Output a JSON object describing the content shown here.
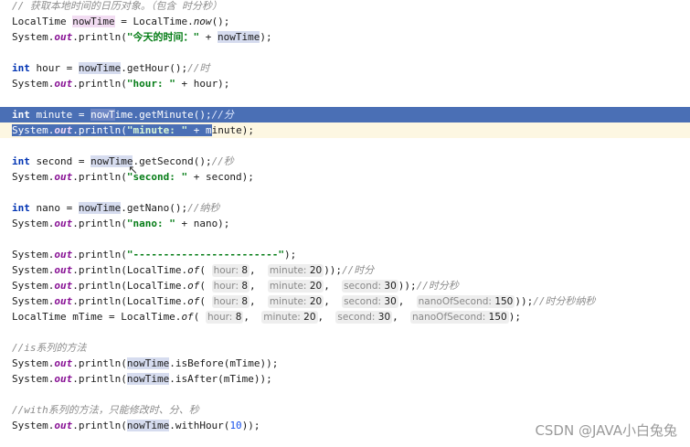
{
  "lines": {
    "l1": "// 获取本地时间的日历对象。（包含 时分秒）",
    "l2_type": "LocalTime",
    "l2_var": "nowTime",
    "l2_eq": " = LocalTime.",
    "l2_method": "now",
    "l2_end": "();",
    "l3_pre": "System.",
    "l3_out": "out",
    "l3_mid": ".println(",
    "l3_str": "\"今天的时间：\"",
    "l3_plus": " + ",
    "l3_var": "nowTime",
    "l3_end": ");",
    "l5_kw": "int",
    "l5_mid": " hour = ",
    "l5_var": "nowTime",
    "l5_call": ".getHour();",
    "l5_cm": "//时",
    "l6_str": "\"hour: \"",
    "l6_end": " + hour);",
    "l8_kw": "int",
    "l8_mid": " minute = ",
    "l8_var_a": "nowT",
    "l8_var_b": "ime",
    "l8_call": ".getMinute();",
    "l8_cm": "//分",
    "l9_str": "\"minute: \"",
    "l9_plus": " + ",
    "l9_sel_tail": "m",
    "l9_end": "inute);",
    "l11_kw": "int",
    "l11_mid": " second = ",
    "l11_var": "nowTime",
    "l11_call": ".getSecond();",
    "l11_cm": "//秒",
    "l12_str": "\"second: \"",
    "l12_end": " + second);",
    "l14_kw": "int",
    "l14_mid": " nano = ",
    "l14_var": "nowTime",
    "l14_call": ".getNano();",
    "l14_cm": "//纳秒",
    "l15_str": "\"nano: \"",
    "l15_end": " + nano);",
    "l17_str": "\"------------------------\"",
    "l17_end": ");",
    "of_pre": ".println(LocalTime.",
    "of": "of",
    "paren": "(",
    "hint_hour": "hour:",
    "hint_minute": "minute:",
    "hint_second": "second:",
    "hint_nano": "nanoOfSecond:",
    "v8": "8",
    "v20": "20",
    "v30": "30",
    "v150": "150",
    "comma": ",",
    "l18_end": "));",
    "l18_cm": "//时分",
    "l19_end": "));",
    "l19_cm": "//时分秒",
    "l20_end": "));",
    "l20_cm": "//时分秒纳秒",
    "l21_pre": "LocalTime mTime = LocalTime.",
    "l21_end": ");",
    "l23_cm": "//is系列的方法",
    "l24_mid": ".println(",
    "l24_var": "nowTime",
    "l24_end": ".isBefore(mTime));",
    "l25_end": ".isAfter(mTime));",
    "l27_cm": "//with系列的方法，只能修改时、分、秒",
    "l28_end": ".withHour(",
    "l28_num": "10",
    "l28_close": "));"
  },
  "watermark": "CSDN @JAVA小白兔兔",
  "colors": {
    "selection": "#4a6fb5",
    "keyword": "#0033b3",
    "string": "#067d17",
    "static_field": "#871094",
    "comment": "#8c8c8c",
    "number": "#1750eb"
  }
}
